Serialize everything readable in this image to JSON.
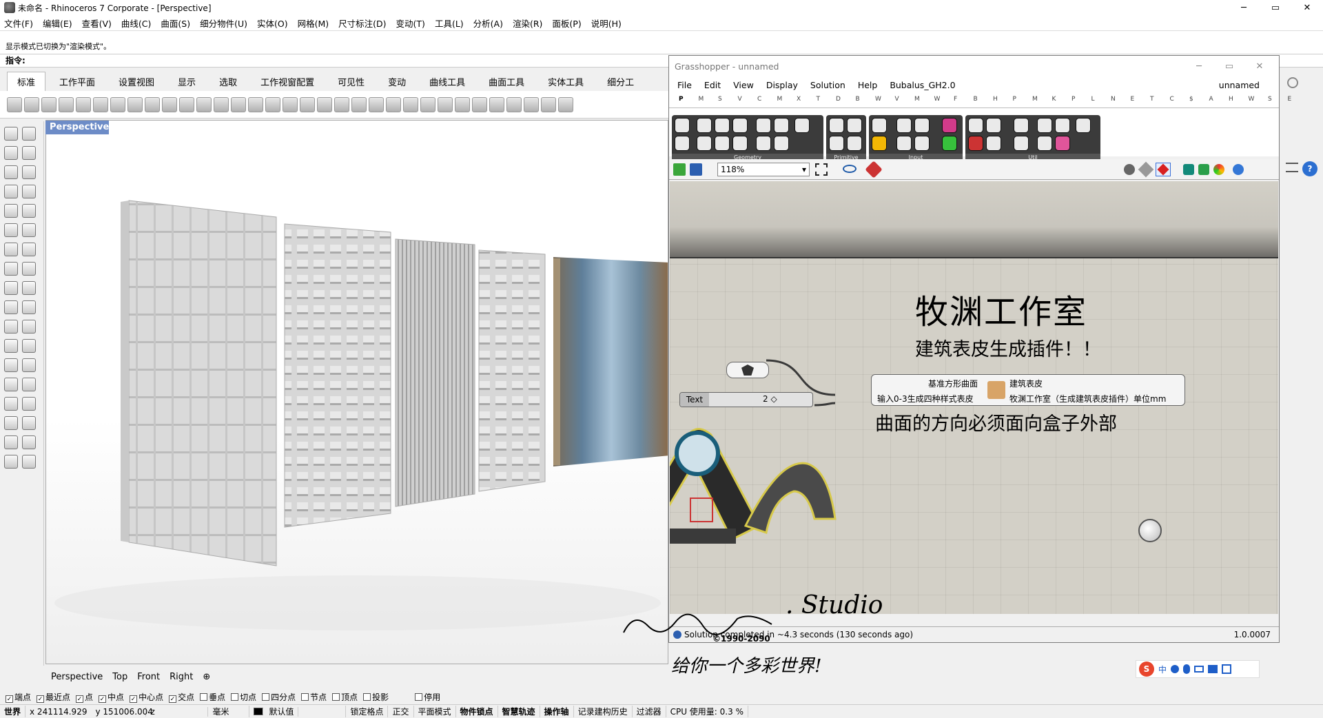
{
  "titlebar": {
    "title": "未命名 - Rhinoceros 7 Corporate - [Perspective]",
    "min": "─",
    "max": "▭",
    "close": "✕"
  },
  "menu": [
    "文件(F)",
    "编辑(E)",
    "查看(V)",
    "曲线(C)",
    "曲面(S)",
    "细分物件(U)",
    "实体(O)",
    "网格(M)",
    "尺寸标注(D)",
    "变动(T)",
    "工具(L)",
    "分析(A)",
    "渲染(R)",
    "面板(P)",
    "说明(H)"
  ],
  "command": {
    "history_line": "显示模式已切换为\"渲染模式\"。",
    "prompt": "指令:"
  },
  "tabs": [
    "标准",
    "工作平面",
    "设置视图",
    "显示",
    "选取",
    "工作视窗配置",
    "可见性",
    "变动",
    "曲线工具",
    "曲面工具",
    "实体工具",
    "细分工"
  ],
  "viewport": {
    "label": "Perspective"
  },
  "viewport_tabs": [
    "Perspective",
    "Top",
    "Front",
    "Right",
    "⊕"
  ],
  "osnaps": [
    {
      "label": "端点",
      "checked": true
    },
    {
      "label": "最近点",
      "checked": true
    },
    {
      "label": "点",
      "checked": true
    },
    {
      "label": "中点",
      "checked": true
    },
    {
      "label": "中心点",
      "checked": true
    },
    {
      "label": "交点",
      "checked": true
    },
    {
      "label": "垂点",
      "checked": false
    },
    {
      "label": "切点",
      "checked": false
    },
    {
      "label": "四分点",
      "checked": false
    },
    {
      "label": "节点",
      "checked": false
    },
    {
      "label": "顶点",
      "checked": false
    },
    {
      "label": "投影",
      "checked": false
    },
    {
      "label": "停用",
      "checked": false
    }
  ],
  "status": {
    "cplane": "世界",
    "x": "x 241114.929",
    "y": "y 151006.004",
    "z": "z",
    "units": "毫米",
    "layer": "默认值",
    "items": [
      "锁定格点",
      "正交",
      "平面模式",
      "物件锁点",
      "智慧轨迹",
      "操作轴",
      "记录建构历史",
      "过滤器"
    ],
    "cpu": "CPU 使用量: 0.3 %"
  },
  "gh": {
    "title": "Grasshopper - unnamed",
    "menu": [
      "File",
      "Edit",
      "View",
      "Display",
      "Solution",
      "Help",
      "Bubalus_GH2.0"
    ],
    "doc_name": "unnamed",
    "tabs": [
      "P",
      "M",
      "S",
      "V",
      "C",
      "M",
      "X",
      "T",
      "D",
      "B",
      "W",
      "V",
      "M",
      "W",
      "F",
      "B",
      "H",
      "P",
      "M",
      "K",
      "P",
      "L",
      "N",
      "E",
      "T",
      "C",
      "$",
      "A",
      "H",
      "W",
      "S",
      "E"
    ],
    "groups": [
      "Geometry",
      "Primitive",
      "Input",
      "Util"
    ],
    "zoom": "118%",
    "canvas": {
      "title": "牧渊工作室",
      "subtitle": "建筑表皮生成插件！！",
      "note": "曲面的方向必须面向盒子外部",
      "text_param": "Text",
      "slider_value": "2 ◇",
      "comp_in1": "基准方形曲面",
      "comp_in2": "输入0-3生成四种样式表皮",
      "comp_out1": "建筑表皮",
      "comp_out2": "牧渊工作室（生成建筑表皮插件）单位mm"
    },
    "status": "Solution completed in ~4.3 seconds (130 seconds ago)",
    "version": "1.0.0007"
  },
  "watermark": {
    "studio": ". Studio",
    "years": "©1990-2090",
    "slogan": "给你一个多彩世界!"
  }
}
